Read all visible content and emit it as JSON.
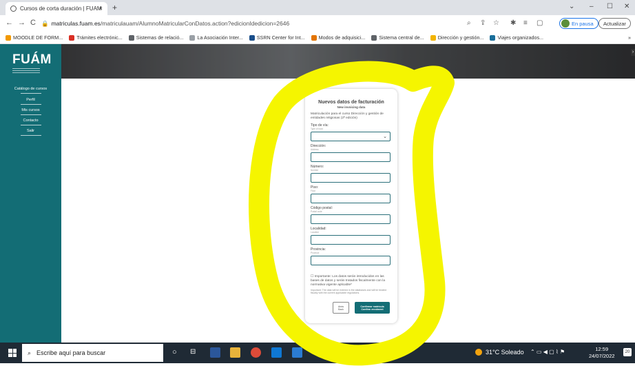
{
  "browser": {
    "tab_title": "Cursos de corta duración | FUAM",
    "tab_close": "×",
    "new_tab": "+",
    "window_controls": [
      "⌄",
      "–",
      "☐",
      "✕"
    ],
    "url_host": "matriculas.fuam.es",
    "url_path": "/matriculauam/AlumnoMatricularConDatos.action?edicionIdedicion=2646",
    "profile_status": "En pausa",
    "update_label": "Actualizar",
    "bookmarks": [
      {
        "label": "MOODLE DE FORM...",
        "color": "#f29900"
      },
      {
        "label": "Trámites electrónic...",
        "color": "#d93025"
      },
      {
        "label": "Sistemas de relació...",
        "color": "#5f6368"
      },
      {
        "label": "La Asociación Inter...",
        "color": "#9aa0a6"
      },
      {
        "label": "SSRN Center for Int...",
        "color": "#1a4e8a"
      },
      {
        "label": "Modos de adquisici...",
        "color": "#e37400"
      },
      {
        "label": "Sistema central de...",
        "color": "#5f6368"
      },
      {
        "label": "Dirección y gestión...",
        "color": "#f2b400"
      },
      {
        "label": "Viajes organizados...",
        "color": "#1a6e9a"
      }
    ],
    "bookmarks_more": "»"
  },
  "sidebar": {
    "logo": "FUÁM",
    "items": [
      {
        "label": "Catálogo de cursos"
      },
      {
        "label": "Perfil"
      },
      {
        "label": "Mis cursos"
      },
      {
        "label": "Contacto"
      },
      {
        "label": "Salir"
      }
    ]
  },
  "form": {
    "title": "Nuevos datos de facturación",
    "subtitle": "New invoicing data",
    "description": "Matriculación para el curso Dirección y gestión de entidades religiosas (2ª edición)",
    "fields": [
      {
        "label": "Tipo de vía:",
        "sub": "Type of road",
        "type": "select"
      },
      {
        "label": "Dirección:",
        "sub": "Address",
        "type": "text"
      },
      {
        "label": "Número:",
        "sub": "Number",
        "type": "text"
      },
      {
        "label": "Piso:",
        "sub": "Floor",
        "type": "text"
      },
      {
        "label": "Código postal:",
        "sub": "Postal code",
        "type": "text"
      },
      {
        "label": "Localidad:",
        "sub": "Location",
        "type": "text"
      },
      {
        "label": "Provincia:",
        "sub": "Province",
        "type": "text"
      }
    ],
    "notice": "Importante: Los datos serán introducidos en las bases de datos y serán tratados fiscalmente con la normativa vigente aplicable*",
    "notice_en": "Important: The data will be entered in the databases and will be treated fiscally with the current applicable regulations.",
    "back_label": "Atrás",
    "back_label_en": "Back",
    "confirm_label": "Confirmar matrícula",
    "confirm_label_en": "Confirm enrolment"
  },
  "taskbar": {
    "search_placeholder": "Escribe aquí para buscar",
    "weather": "31°C  Soleado",
    "time": "12:59",
    "date": "24/07/2022",
    "notifications": "20"
  },
  "colors": {
    "brand": "#136d75",
    "annotation": "#f5f500"
  }
}
